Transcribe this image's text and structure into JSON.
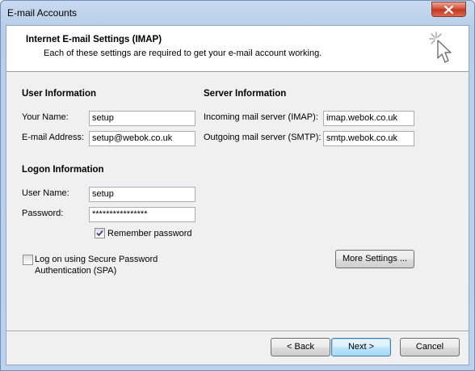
{
  "window": {
    "title": "E-mail Accounts"
  },
  "header": {
    "title": "Internet E-mail Settings (IMAP)",
    "subtitle": "Each of these settings are required to get your e-mail account working."
  },
  "user_info": {
    "section_title": "User Information",
    "your_name_label": "Your Name:",
    "your_name_value": "setup",
    "email_label": "E-mail Address:",
    "email_value": "setup@webok.co.uk"
  },
  "server_info": {
    "section_title": "Server Information",
    "incoming_label": "Incoming mail server (IMAP):",
    "incoming_value": "imap.webok.co.uk",
    "outgoing_label": "Outgoing mail server (SMTP):",
    "outgoing_value": "smtp.webok.co.uk"
  },
  "logon_info": {
    "section_title": "Logon Information",
    "username_label": "User Name:",
    "username_value": "setup",
    "password_label": "Password:",
    "password_value": "****************",
    "remember_label": "Remember password",
    "remember_checked": true,
    "spa_label_line1": "Log on using Secure Password",
    "spa_label_line2": "Authentication (SPA)",
    "spa_checked": false
  },
  "buttons": {
    "more_settings": "More Settings ...",
    "back": "< Back",
    "next": "Next >",
    "cancel": "Cancel"
  },
  "icons": {
    "close": "close-icon",
    "wizard": "cursor-sparkle-icon",
    "check": "checkmark-icon"
  }
}
